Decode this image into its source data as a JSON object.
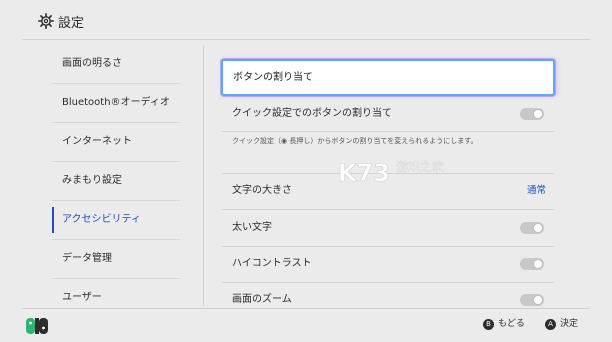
{
  "header": {
    "title": "設定",
    "icon": "gear-icon"
  },
  "sidebar": {
    "items": [
      {
        "label": "画面の明るさ"
      },
      {
        "label": "Bluetooth®オーディオ"
      },
      {
        "label": "インターネット"
      },
      {
        "label": "みまもり設定"
      },
      {
        "label": "アクセシビリティ"
      },
      {
        "label": "データ管理"
      },
      {
        "label": "ユーザー"
      }
    ],
    "selected_label": "アクセシビリティ"
  },
  "main": {
    "button_mapping": "ボタンの割り当て",
    "quick_settings_mapping": {
      "label": "クイック設定でのボタンの割り当て",
      "on": false
    },
    "hint": "クイック設定（◉ 長押し）からボタンの割り当てを変えられるようにします。",
    "text_size": {
      "label": "文字の大きさ",
      "value": "通常"
    },
    "bold_text": {
      "label": "太い文字",
      "on": false
    },
    "high_contrast": {
      "label": "ハイコントラスト",
      "on": false
    },
    "screen_zoom": {
      "label": "画面のズーム",
      "on": false
    }
  },
  "footer": {
    "back": {
      "key": "B",
      "label": "もどる"
    },
    "ok": {
      "key": "A",
      "label": "決定"
    }
  },
  "watermark": {
    "logo": "K73",
    "text": "游戏之家"
  },
  "colors": {
    "accent": "#1f4fd0",
    "background": "#ebebeb",
    "focus": "#5ea8f0"
  }
}
